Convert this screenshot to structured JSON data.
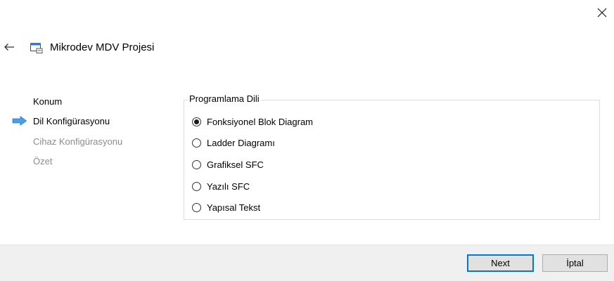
{
  "header": {
    "title": "Mikrodev MDV Projesi"
  },
  "steps": [
    {
      "label": "Konum",
      "state": "done"
    },
    {
      "label": "Dil Konfigürasyonu",
      "state": "current"
    },
    {
      "label": "Cihaz Konfigürasyonu",
      "state": "pending"
    },
    {
      "label": "Özet",
      "state": "pending"
    }
  ],
  "group": {
    "legend": "Programlama Dili",
    "options": [
      {
        "label": "Fonksiyonel Blok Diagram",
        "selected": true
      },
      {
        "label": "Ladder Diagramı",
        "selected": false
      },
      {
        "label": "Grafiksel SFC",
        "selected": false
      },
      {
        "label": "Yazılı SFC",
        "selected": false
      },
      {
        "label": "Yapısal Tekst",
        "selected": false
      }
    ]
  },
  "buttons": {
    "next": "Next",
    "cancel": "İptal"
  },
  "icons": {
    "close": "close-icon",
    "back": "back-arrow-icon",
    "project": "project-window-icon",
    "current_step": "current-step-arrow-icon"
  },
  "colors": {
    "accent": "#0078d7",
    "arrow_fill": "#4a9de8",
    "pending_text": "#8c8c8c",
    "footer_bg": "#f0f0f0",
    "button_bg": "#e1e1e1"
  }
}
